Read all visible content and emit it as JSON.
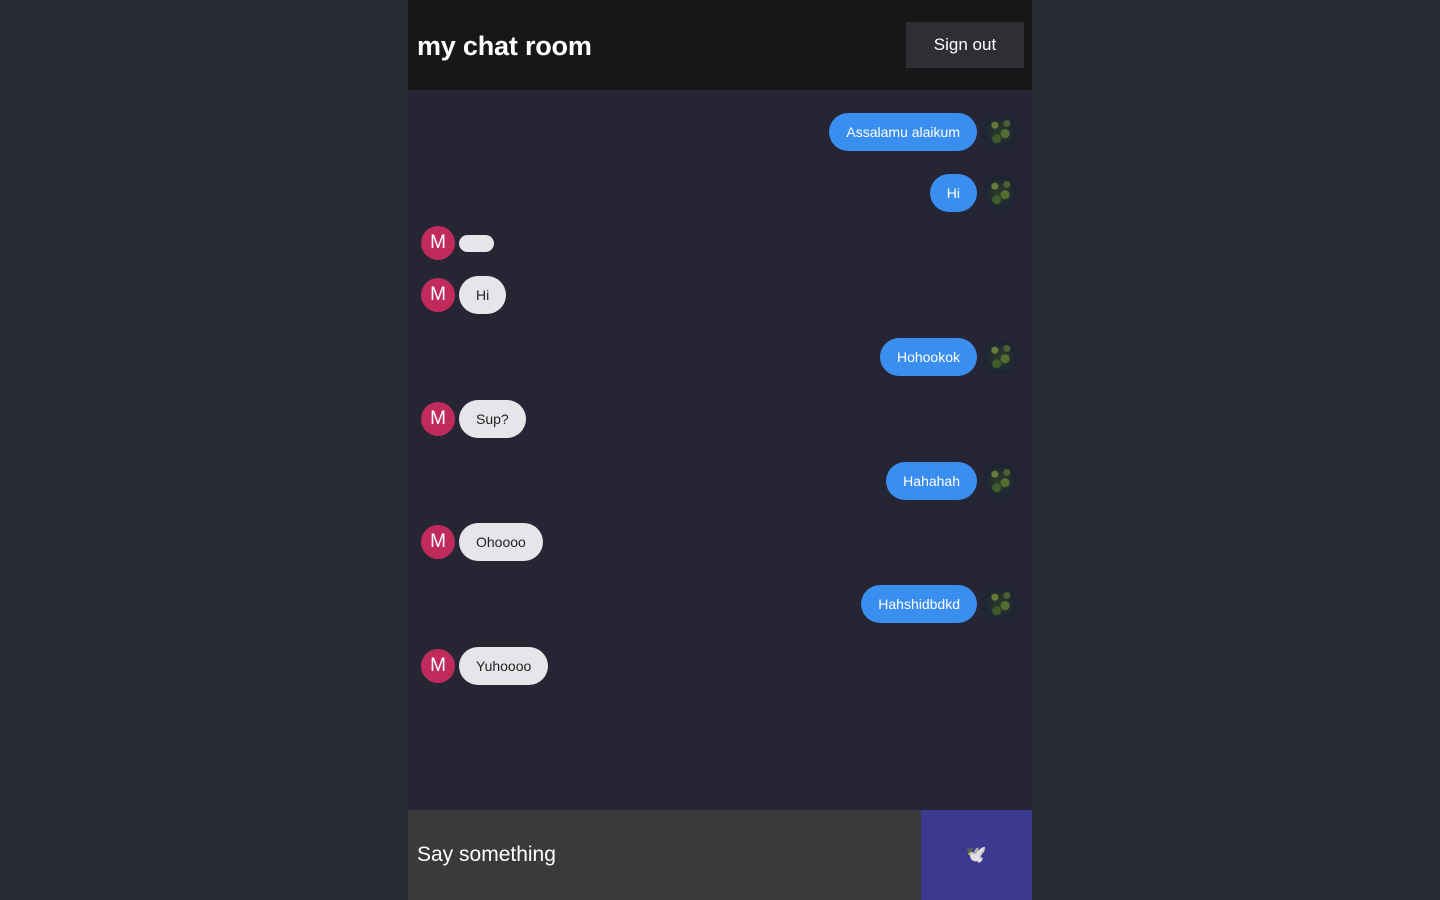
{
  "header": {
    "title": "my chat room",
    "sign_out_label": "Sign out"
  },
  "messages": [
    {
      "direction": "sent",
      "text": "Assalamu alaikum",
      "avatar": "user-photo"
    },
    {
      "direction": "sent",
      "text": "Hi",
      "avatar": "user-photo"
    },
    {
      "direction": "received",
      "text": "",
      "avatar_letter": "M"
    },
    {
      "direction": "received",
      "text": "Hi",
      "avatar_letter": "M"
    },
    {
      "direction": "sent",
      "text": "Hohookok",
      "avatar": "user-photo"
    },
    {
      "direction": "received",
      "text": "Sup?",
      "avatar_letter": "M"
    },
    {
      "direction": "sent",
      "text": "Hahahah",
      "avatar": "user-photo"
    },
    {
      "direction": "received",
      "text": "Ohoooo",
      "avatar_letter": "M"
    },
    {
      "direction": "sent",
      "text": "Hahshidbdkd",
      "avatar": "user-photo"
    },
    {
      "direction": "received",
      "text": "Yuhoooo",
      "avatar_letter": "M"
    }
  ],
  "composer": {
    "placeholder": "Say something",
    "send_icon": "dove-icon",
    "send_glyph": "🕊️"
  },
  "colors": {
    "page_background": "#282c34",
    "chat_background": "#262533",
    "header_background": "#181717",
    "sent_bubble": "#3a8ef0",
    "received_bubble": "#e6e6ea",
    "received_avatar": "#c12b5c",
    "send_button": "#3b3a8f"
  }
}
